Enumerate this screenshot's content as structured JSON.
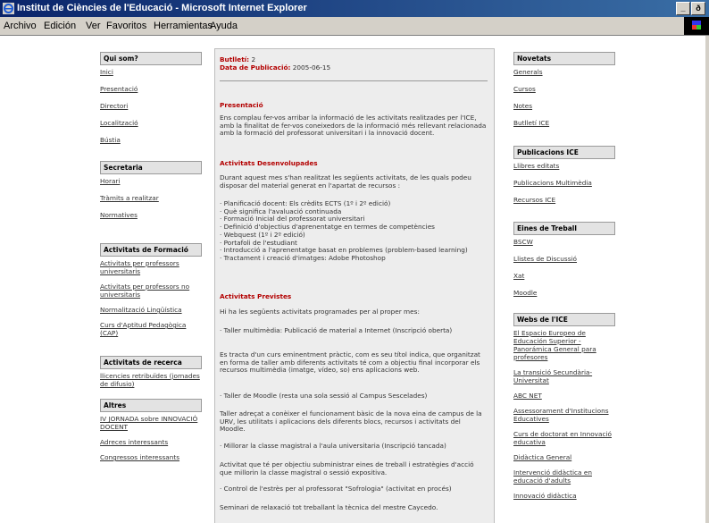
{
  "window": {
    "title": "Institut de Ciències de l'Educació - Microsoft Internet Explorer",
    "controls": [
      "_",
      "ð"
    ]
  },
  "menu": [
    "Archivo",
    "Edición",
    "Ver",
    "Favoritos",
    "Herramientas",
    "Ayuda"
  ],
  "left": {
    "sections": [
      {
        "title": "Qui som?",
        "items": [
          "Inici",
          "Presentació",
          "Directori",
          "Localització",
          "Bústia"
        ]
      },
      {
        "title": "Secretaria",
        "items": [
          "Horari",
          "Tràmits a realitzar",
          "Normatives"
        ]
      },
      {
        "title": "Activitats de Formació",
        "items": [
          "Activitats per professors universitaris",
          "Activitats per professors no universitaris",
          "Normalització Lingüística",
          "Curs d'Aptitud Pedagògica (CAP)"
        ]
      },
      {
        "title": "Activitats de recerca",
        "items": [
          "llicencies retribuïdes (jornades de difusio)"
        ]
      },
      {
        "title": "Altres",
        "items": [
          "IV JORNADA sobre INNOVACIÓ DOCENT",
          "Adreces interessants",
          "Congressos interessants"
        ]
      }
    ]
  },
  "main": {
    "bulleti_label": "Butlletí:",
    "bulleti_value": "2",
    "date_label": "Data de Publicació:",
    "date_value": "2005-06-15",
    "presentacio_title": "Presentació",
    "presentacio_text": "Ens complau fer-vos arribar la informació de les activitats realitzades per l'ICE, amb la finalitat de fer-vos coneixedors de la informació més rellevant relacionada amb la formació del professorat universitari i la innovació docent.",
    "desenvolupades_title": "Activitats Desenvolupades",
    "desenvolupades_intro": "Durant aquest mes s'han realitzat les següents activitats, de les quals podeu disposar del material generat en l'apartat de recursos :",
    "desenvolupades_items": [
      "· Planificació docent: Els crèdits ECTS (1º i 2º edició)",
      "· Què significa l'avaluació continuada",
      "· Formació Inicial del professorat universitari",
      "· Definició d'objectius d'aprenentatge en termes de competències",
      "· Webquest (1º i 2º edició)",
      "· Portafoli de l'estudiant",
      "· Introducció a l'aprenentatge basat en problemes (problem-based learning)",
      "· Tractament i creació d'imatges: Adobe Photoshop"
    ],
    "previstes_title": "Activitats Previstes",
    "previstes_intro": "Hi ha les següents activitats programades per al proper mes:",
    "p1": "· Taller multimèdia: Publicació de material a Internet (Inscripció oberta)",
    "p2": "Es tracta d'un curs eminentment pràctic, com es seu títol indica, que organitzat en forma de taller amb diferents activitats té com a objectiu final incorporar els recursos multimèdia (imatge, vídeo, so) ens aplicacions web.",
    "p3": "· Taller de Moodle (resta una sola sessió al Campus Sescelades)",
    "p4": "Taller adreçat a conèixer el funcionament bàsic de la nova eina de campus de la URV, les utilitats i aplicacions dels diferents blocs, recursos i activitats del Moodle.",
    "p5": "· Millorar la classe magistral a l'aula universitaria (Inscripció tancada)",
    "p6": "Activitat que té per objectiu subministrar eines de treball i estratègies d'acció que millorin la classe magistral o sessió expositiva.",
    "p7": "· Control de l'estrès per al professorat \"Sofrologia\" (activitat en procés)",
    "p8": "Seminari de relaxació tot treballant la tècnica del mestre Caycedo."
  },
  "right": {
    "sections": [
      {
        "title": "Novetats",
        "items": [
          "Generals",
          "Cursos",
          "Notes",
          "Butlletí ICE"
        ]
      },
      {
        "title": "Publicacions ICE",
        "items": [
          "Llibres editats",
          "Publicacions Multimèdia",
          "Recursos ICE"
        ]
      },
      {
        "title": "Eines de Treball",
        "items": [
          "BSCW",
          "Llistes de Discussió",
          "Xat",
          "Moodle"
        ]
      },
      {
        "title": "Webs de l'ICE",
        "items": [
          "El Espacio Europeo de Educación Superior - Panorámica General para profesores",
          "La transició Secundària-Universitat",
          "ABC NET",
          "Assessorament d'Institucions Educatives",
          "Curs de doctorat en Innovació educativa",
          "Didàctica General",
          "Intervenció didàctica en educació d'adults",
          "Innovació didàctica"
        ]
      }
    ]
  }
}
